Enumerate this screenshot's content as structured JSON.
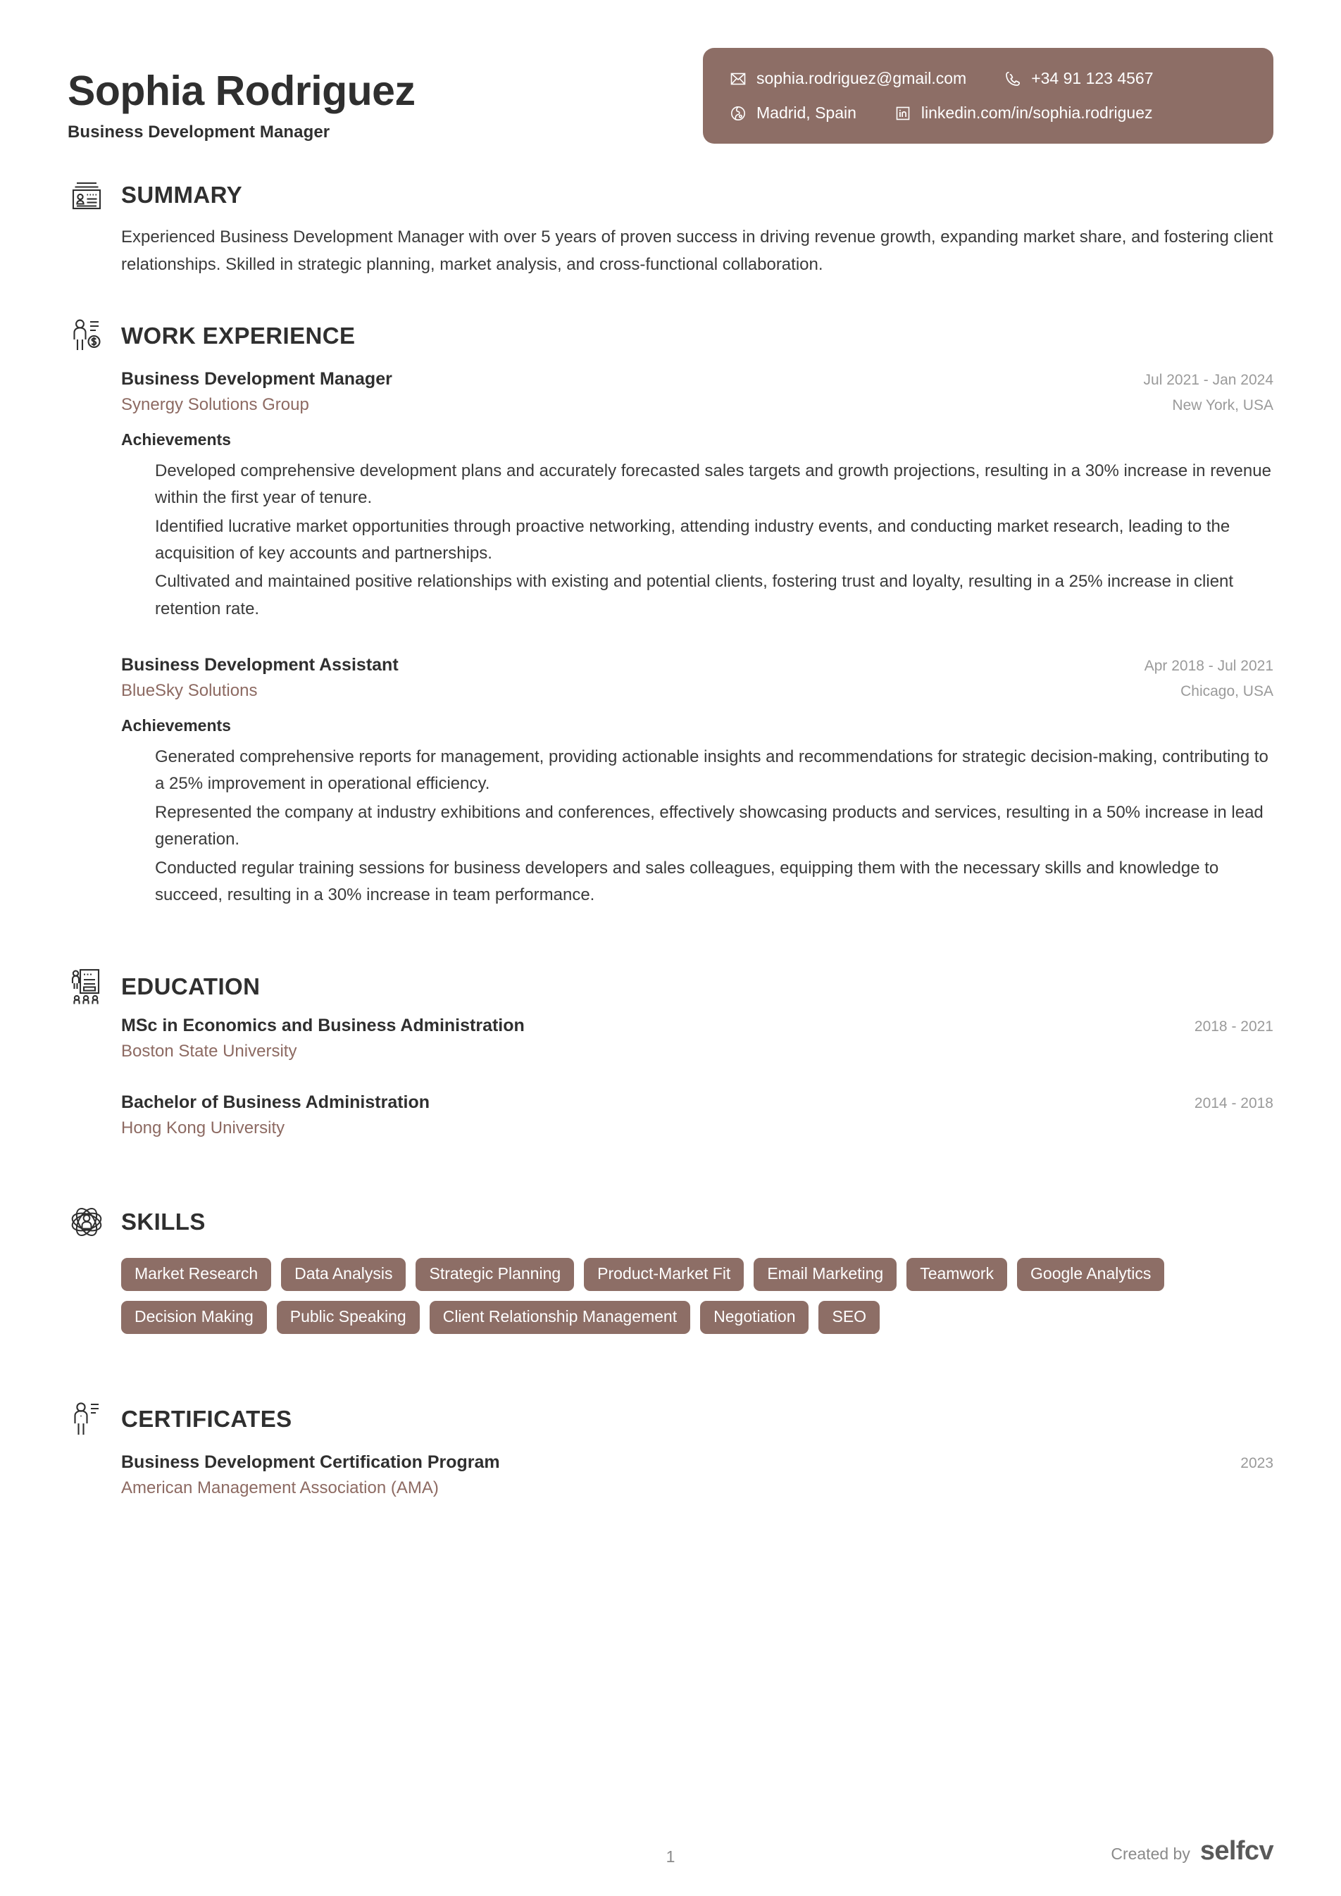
{
  "header": {
    "name": "Sophia Rodriguez",
    "job_title": "Business Development Manager",
    "contact": {
      "email": "sophia.rodriguez@gmail.com",
      "phone": "+34 91 123 4567",
      "location": "Madrid, Spain",
      "linkedin": "linkedin.com/in/sophia.rodriguez"
    }
  },
  "colors": {
    "brand": "#8d6e66",
    "accent_text": "#8d6a62",
    "heading": "#2f2f2f",
    "muted": "#9a9a9a"
  },
  "sections": {
    "summary": {
      "title": "SUMMARY",
      "icon": "id-card-icon",
      "text": "Experienced Business Development Manager with over 5 years of proven success in driving revenue growth, expanding market share, and fostering client relationships. Skilled in strategic planning, market analysis, and cross-functional collaboration."
    },
    "work": {
      "title": "WORK EXPERIENCE",
      "icon": "person-money-icon",
      "entries": [
        {
          "role": "Business Development Manager",
          "organization": "Synergy Solutions Group",
          "dates": "Jul 2021 - Jan 2024",
          "location": "New York, USA",
          "achievements_label": "Achievements",
          "achievements": [
            "Developed comprehensive development plans and accurately forecasted sales targets and growth projections, resulting in a 30% increase in revenue within the first year of tenure.",
            "Identified lucrative market opportunities through proactive networking, attending industry events, and conducting market research, leading to the acquisition of key accounts and partnerships.",
            "Cultivated and maintained positive relationships with existing and potential clients, fostering trust and loyalty, resulting in a 25% increase in client retention rate."
          ]
        },
        {
          "role": "Business Development Assistant",
          "organization": "BlueSky Solutions",
          "dates": "Apr 2018 - Jul 2021",
          "location": "Chicago, USA",
          "achievements_label": "Achievements",
          "achievements": [
            "Generated comprehensive reports for management, providing actionable insights and recommendations for strategic decision-making, contributing to a 25% improvement in operational efficiency.",
            "Represented the company at industry exhibitions and conferences, effectively showcasing products and services, resulting in a 50% increase in lead generation.",
            "Conducted regular training sessions for business developers and sales colleagues, equipping them with the necessary skills and knowledge to succeed, resulting in a 30% increase in team performance."
          ]
        }
      ]
    },
    "education": {
      "title": "EDUCATION",
      "icon": "presentation-board-icon",
      "entries": [
        {
          "degree": "MSc in Economics and Business Administration",
          "institution": "Boston State University",
          "dates": "2018 - 2021"
        },
        {
          "degree": "Bachelor of Business Administration",
          "institution": "Hong Kong University",
          "dates": "2014 - 2018"
        }
      ]
    },
    "skills": {
      "title": "SKILLS",
      "icon": "person-network-icon",
      "tags": [
        "Market Research",
        "Data Analysis",
        "Strategic Planning",
        "Product-Market Fit",
        "Email Marketing",
        "Teamwork",
        "Google Analytics",
        "Decision Making",
        "Public Speaking",
        "Client Relationship Management",
        "Negotiation",
        "SEO"
      ]
    },
    "certificates": {
      "title": "CERTIFICATES",
      "icon": "person-list-icon",
      "entries": [
        {
          "name": "Business Development Certification Program",
          "issuer": "American Management Association (AMA)",
          "date": "2023"
        }
      ]
    }
  },
  "footer": {
    "page_number": "1",
    "created_by_label": "Created by",
    "brand": "selfcv"
  }
}
